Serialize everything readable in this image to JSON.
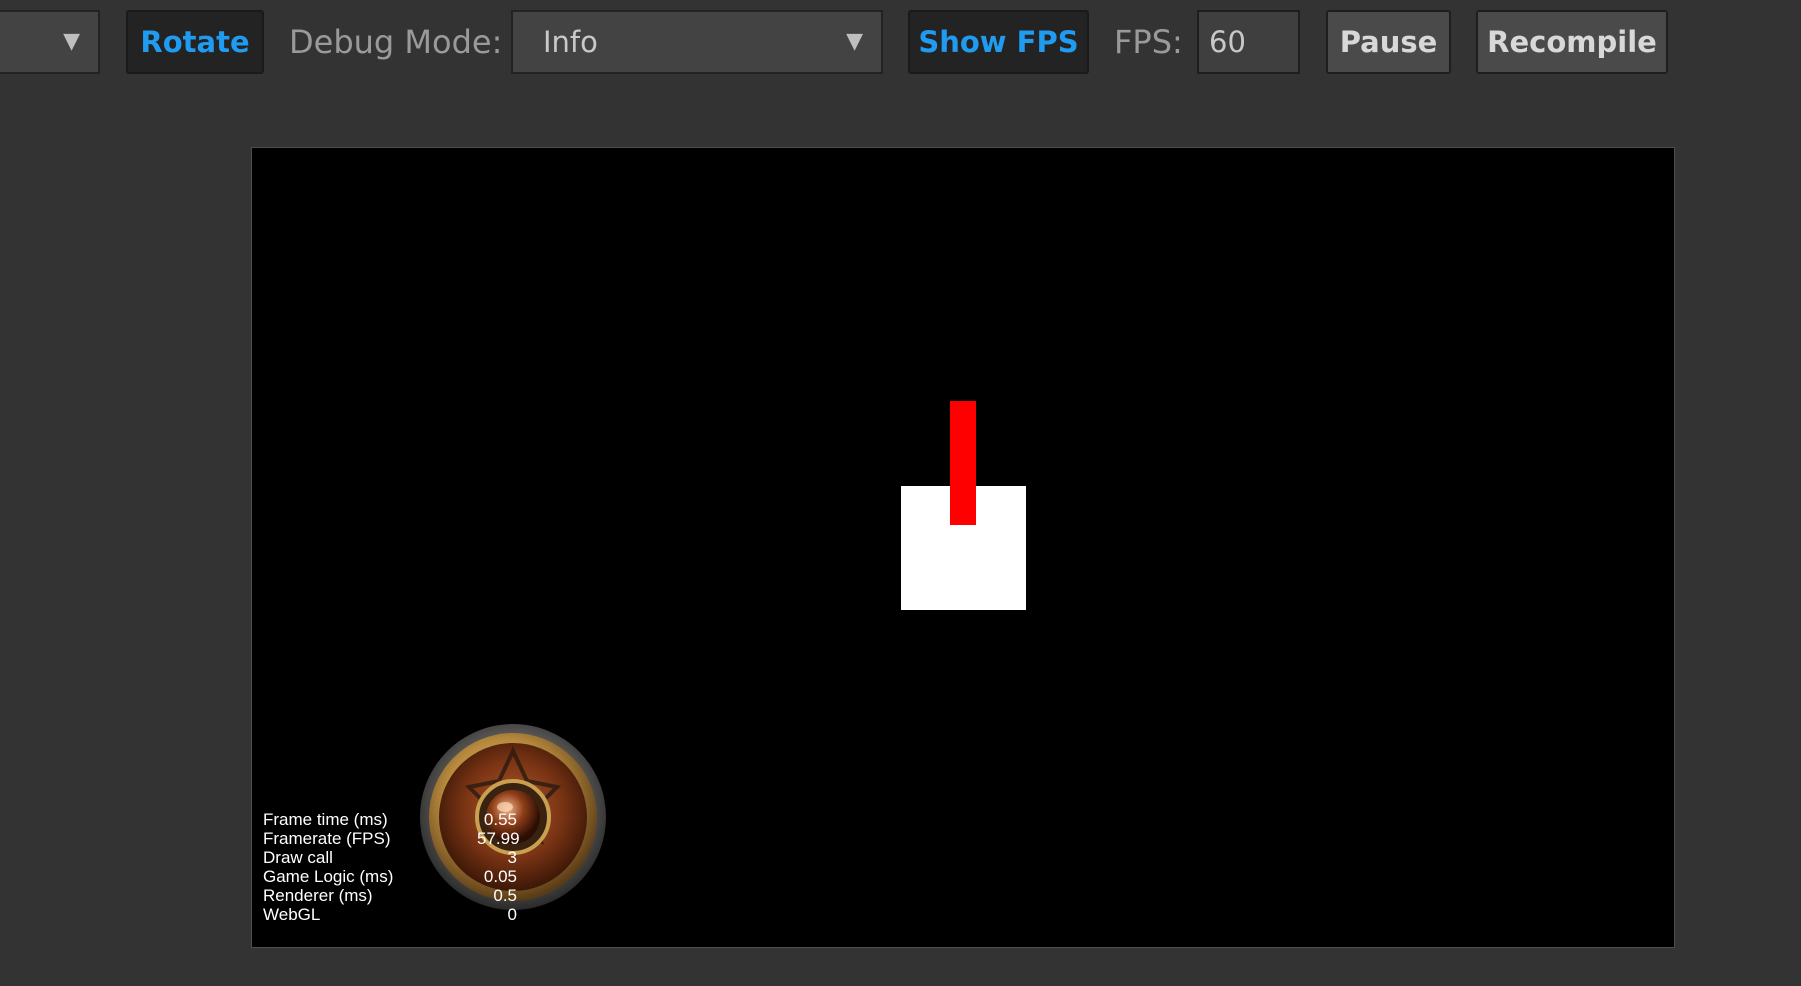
{
  "toolbar": {
    "first_select_value": "",
    "rotate_label": "Rotate",
    "debug_mode_label": "Debug Mode:",
    "debug_mode_value": "Info",
    "show_fps_label": "Show FPS",
    "fps_label": "FPS:",
    "fps_value": "60",
    "pause_label": "Pause",
    "recompile_label": "Recompile",
    "dropdown_arrow": "▼"
  },
  "scene": {
    "square_color": "#ffffff",
    "bar_color": "#ff0000",
    "background_color": "#000000"
  },
  "stats": {
    "rows": [
      {
        "label": "Frame time (ms)",
        "value": "0.55"
      },
      {
        "label": "Framerate (FPS)",
        "value": "57.99"
      },
      {
        "label": "Draw call",
        "value": "3"
      },
      {
        "label": "Game Logic (ms)",
        "value": "0.05"
      },
      {
        "label": "Renderer (ms)",
        "value": "0.5"
      },
      {
        "label": "WebGL",
        "value": "0"
      }
    ]
  },
  "colors": {
    "accent": "#1f9bf0",
    "toolbar_bg": "#333333"
  }
}
